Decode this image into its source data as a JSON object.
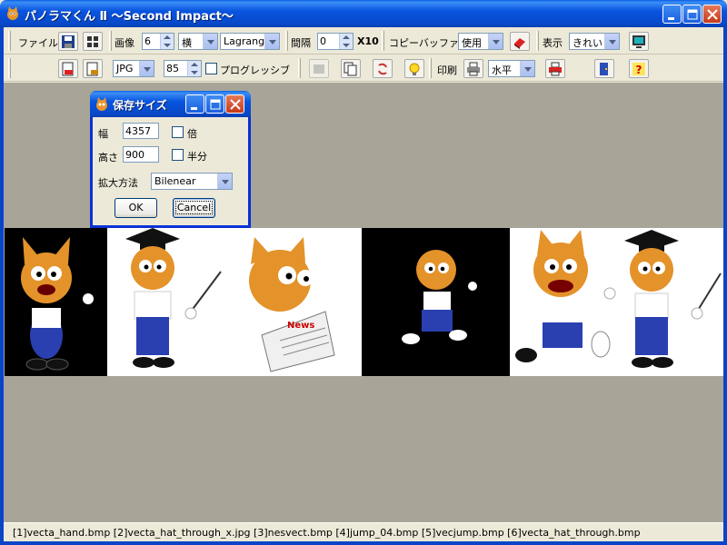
{
  "window": {
    "title": "パノラマくん Ⅱ ～Second Impact～",
    "accent": "#0a5fe6"
  },
  "toolbar1": {
    "file_label": "ファイル",
    "image_label": "画像",
    "image_count": "6",
    "orientation": "横",
    "interpolation": "Lagrange",
    "spacing_label": "間隔",
    "spacing_value": "0",
    "spacing_multiplier": "X10",
    "copy_buffer_label": "コピーバッファ",
    "copy_buffer_value": "使用",
    "display_label": "表示",
    "display_value": "きれい"
  },
  "toolbar2": {
    "format": "JPG",
    "quality": "85",
    "progressive_label": "プログレッシブ",
    "print_label": "印刷",
    "print_direction": "水平"
  },
  "dialog": {
    "title": "保存サイズ",
    "width_label": "幅",
    "width_value": "4357",
    "height_label": "高さ",
    "height_value": "900",
    "double_label": "倍",
    "half_label": "半分",
    "method_label": "拡大方法",
    "method_value": "Bilenear",
    "ok_label": "OK",
    "cancel_label": "Cancel"
  },
  "status": {
    "text": "[1]vecta_hand.bmp  [2]vecta_hat_through_x.jpg  [3]nesvect.bmp  [4]jump_04.bmp  [5]vecjump.bmp  [6]vecta_hat_through.bmp"
  },
  "panorama": {
    "panels": [
      {
        "name": "vecta_hand.bmp",
        "bg": "#000000"
      },
      {
        "name": "vecta_hat_through_x.jpg",
        "bg": "#ffffff"
      },
      {
        "name": "nesvect.bmp",
        "bg": "#ffffff"
      },
      {
        "name": "jump_04.bmp",
        "bg": "#000000"
      },
      {
        "name": "vecjump.bmp",
        "bg": "#ffffff"
      },
      {
        "name": "vecta_hat_through.bmp",
        "bg": "#ffffff"
      }
    ]
  }
}
